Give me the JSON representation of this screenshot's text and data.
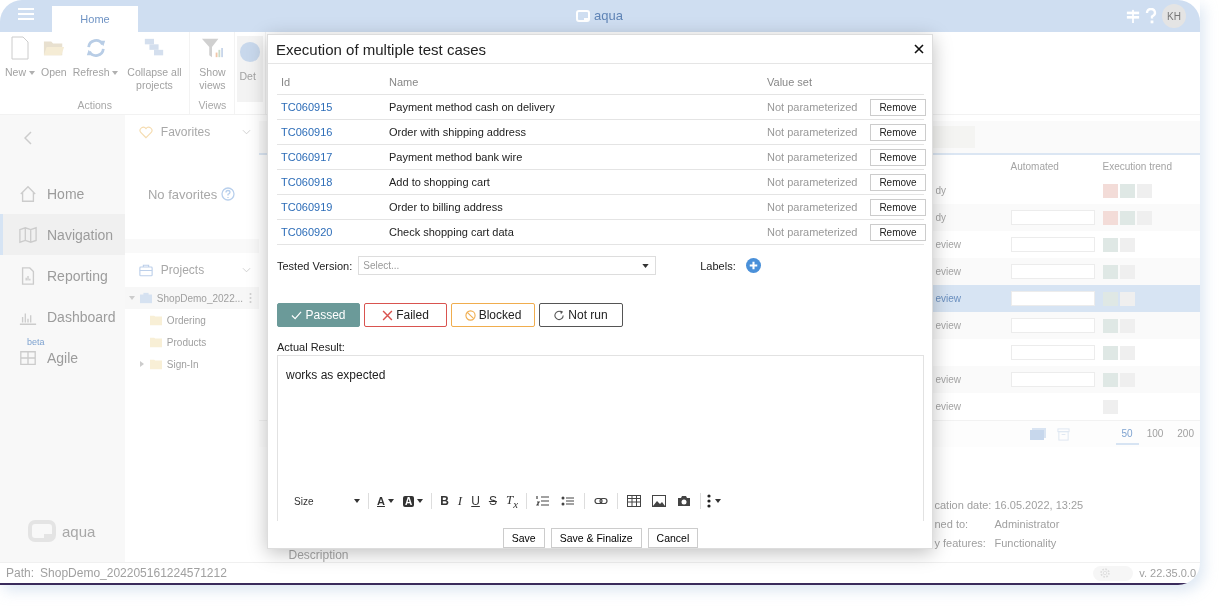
{
  "topbar": {
    "tabs": [
      {
        "label": "Home",
        "selected": true
      }
    ],
    "logo": "aqua",
    "avatar": "KH"
  },
  "ribbon": {
    "groups": [
      {
        "label": "Actions",
        "buttons": [
          {
            "kind": "new",
            "label": "New",
            "dropdown": true
          },
          {
            "kind": "open",
            "label": "Open",
            "dropdown": false
          },
          {
            "kind": "refresh",
            "label": "Refresh",
            "dropdown": true
          },
          {
            "kind": "collapse",
            "label": "Collapse all projects",
            "dropdown": false
          }
        ]
      },
      {
        "label": "Views",
        "buttons": [
          {
            "kind": "views",
            "label": "Show views",
            "dropdown": false
          }
        ]
      },
      {
        "buttons": [
          {
            "kind": "details",
            "label": "Det",
            "dropdown": false
          }
        ]
      }
    ]
  },
  "nav": {
    "items": [
      {
        "kind": "home",
        "label": "Home",
        "selected": false
      },
      {
        "kind": "navigation",
        "label": "Navigation",
        "selected": true
      },
      {
        "kind": "reporting",
        "label": "Reporting",
        "selected": false
      },
      {
        "kind": "dashboard",
        "label": "Dashboard",
        "selected": false
      },
      {
        "kind": "agile",
        "label": "Agile",
        "badge": "beta",
        "selected": false
      }
    ],
    "brand": "aqua"
  },
  "favorites": {
    "title": "Favorites",
    "empty_text": "No favorites"
  },
  "projects": {
    "title": "Projects",
    "tree": [
      {
        "label": "ShopDemo_2022...",
        "expanded": true,
        "children": [
          {
            "label": "Ordering"
          },
          {
            "label": "Products"
          },
          {
            "label": "Sign-In",
            "expanded": false
          }
        ]
      }
    ]
  },
  "content": {
    "columns": [
      "Automated",
      "Execution trend"
    ],
    "rows": [
      {
        "status": "dy",
        "automated_field": false,
        "selected": false,
        "trend": [
          {
            "color": "#f3dcd8"
          },
          {
            "color": "#dfe8e5"
          },
          {
            "color": "#efefef"
          }
        ]
      },
      {
        "status": "dy",
        "automated_field": true,
        "selected": false,
        "trend": [
          {
            "color": "#f3dcd8"
          },
          {
            "color": "#dfe8e5"
          },
          {
            "color": "#efefef"
          }
        ]
      },
      {
        "status": "eview",
        "automated_field": true,
        "selected": false,
        "trend": [
          {
            "color": "#dfe8e5"
          },
          {
            "color": "#efefef"
          }
        ]
      },
      {
        "status": "eview",
        "automated_field": true,
        "selected": false,
        "trend": [
          {
            "color": "#dfe8e5"
          },
          {
            "color": "#efefef"
          }
        ]
      },
      {
        "status": "eview",
        "automated_field": true,
        "selected": true,
        "trend": [
          {
            "color": "#dfe8e5"
          },
          {
            "color": "#efefef"
          }
        ]
      },
      {
        "status": "eview",
        "automated_field": true,
        "selected": false,
        "trend": [
          {
            "color": "#dfe8e5"
          },
          {
            "color": "#efefef"
          }
        ]
      },
      {
        "automated_field": true,
        "selected": false,
        "trend": [
          {
            "color": "#dfe8e5"
          },
          {
            "color": "#efefef"
          }
        ]
      },
      {
        "status": "eview",
        "automated_field": true,
        "selected": false,
        "trend": [
          {
            "color": "#dfe8e5"
          },
          {
            "color": "#efefef"
          }
        ]
      },
      {
        "status": "eview",
        "automated_field": false,
        "selected": false,
        "trend": [
          {
            "color": "#efefef"
          }
        ]
      }
    ],
    "page_sizes": [
      {
        "label": "50",
        "selected": true
      },
      {
        "label": "100",
        "selected": false
      },
      {
        "label": "200",
        "selected": false
      }
    ],
    "details": [
      {
        "label": "cation date:",
        "value": "16.05.2022, 13:25"
      },
      {
        "label": "ned to:",
        "value": "Administrator"
      },
      {
        "label": "y features:",
        "value": "Functionality"
      }
    ],
    "section_title": "Description"
  },
  "status_bar": {
    "path_label": "Path:",
    "path": "ShopDemo_202205161224571212",
    "version": "v. 22.35.0.0"
  },
  "dialog": {
    "title": "Execution of multiple test cases",
    "columns": [
      "Id",
      "Name",
      "Value set"
    ],
    "rows": [
      {
        "id": "TC060915",
        "name": "Payment method cash on delivery",
        "value_set": "Not parameterized",
        "action": "Remove"
      },
      {
        "id": "TC060916",
        "name": "Order with shipping address",
        "value_set": "Not parameterized",
        "action": "Remove"
      },
      {
        "id": "TC060917",
        "name": "Payment method bank wire",
        "value_set": "Not parameterized",
        "action": "Remove"
      },
      {
        "id": "TC060918",
        "name": "Add to shopping cart",
        "value_set": "Not parameterized",
        "action": "Remove"
      },
      {
        "id": "TC060919",
        "name": "Order to billing address",
        "value_set": "Not parameterized",
        "action": "Remove"
      },
      {
        "id": "TC060920",
        "name": "Check shopping cart data",
        "value_set": "Not parameterized",
        "action": "Remove"
      }
    ],
    "tested_version": {
      "label": "Tested Version:",
      "placeholder": "Select..."
    },
    "labels": {
      "label": "Labels:"
    },
    "results": [
      {
        "kind": "passed",
        "label": "Passed",
        "selected": true
      },
      {
        "kind": "failed",
        "label": "Failed",
        "selected": false
      },
      {
        "kind": "blocked",
        "label": "Blocked",
        "selected": false
      },
      {
        "kind": "notrun",
        "label": "Not run",
        "selected": false
      }
    ],
    "actual_result": {
      "label": "Actual Result:",
      "value": "works as expected"
    },
    "toolbar": {
      "groups": [
        {
          "items": [
            {
              "kind": "size",
              "label": "Size"
            }
          ]
        },
        {
          "items": [
            {
              "kind": "text-color",
              "label": "A"
            },
            {
              "kind": "bg-color",
              "label": "A"
            }
          ]
        },
        {
          "items": [
            {
              "kind": "bold",
              "label": "B"
            },
            {
              "kind": "italic",
              "label": "I"
            },
            {
              "kind": "underline",
              "label": "U"
            },
            {
              "kind": "strike",
              "label": "S"
            },
            {
              "kind": "clear",
              "label": "T$_{x}$"
            }
          ]
        },
        {
          "items": [
            {
              "kind": "ol"
            },
            {
              "kind": "ul"
            }
          ]
        },
        {
          "items": [
            {
              "kind": "link"
            }
          ]
        },
        {
          "items": [
            {
              "kind": "table"
            },
            {
              "kind": "image"
            },
            {
              "kind": "camera"
            }
          ]
        },
        {
          "items": [
            {
              "kind": "more"
            }
          ]
        }
      ]
    },
    "buttons": [
      "Save",
      "Save & Finalize",
      "Cancel"
    ]
  }
}
